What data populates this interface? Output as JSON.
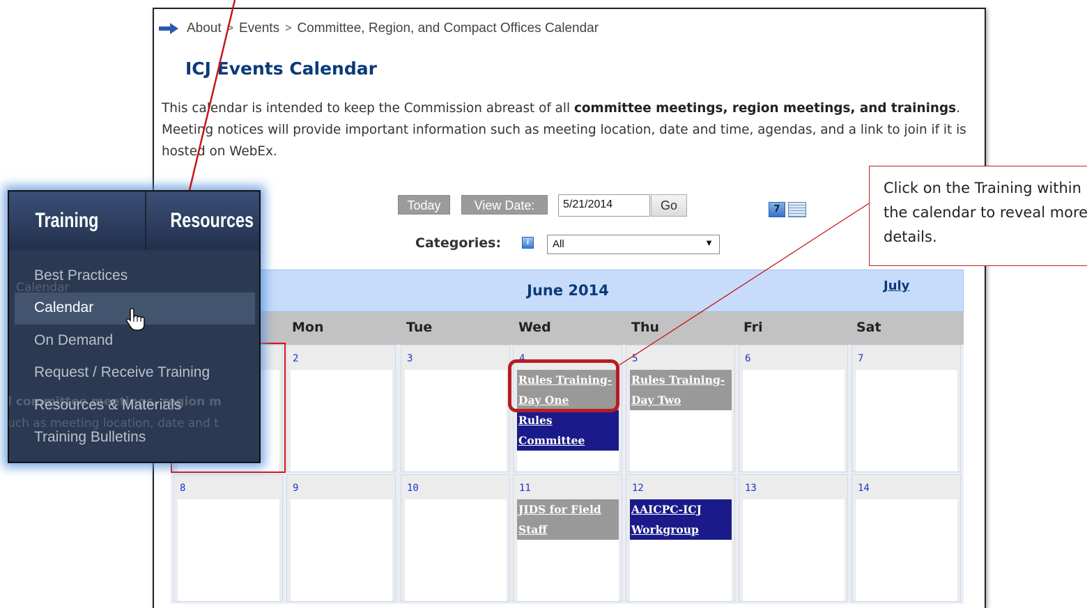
{
  "breadcrumb": {
    "items": [
      "About",
      "Events",
      "Committee, Region, and Compact Offices Calendar"
    ],
    "separator": ">"
  },
  "page": {
    "title": "ICJ Events Calendar",
    "intro_1": "This calendar is intended to keep the Commission abreast of all ",
    "intro_bold": "committee meetings, region meetings, and trainings",
    "intro_2": ". Meeting notices will provide important information such as meeting location, date and time, agendas, and a link to join if it is hosted on WebEx."
  },
  "controls": {
    "today_label": "Today",
    "view_date_label": "View Date:",
    "date_value": "5/21/2014",
    "go_label": "Go",
    "categories_label": "Categories:",
    "category_selected": "All",
    "info_glyph": "i",
    "cal7_glyph": "7"
  },
  "calendar": {
    "month": "June 2014",
    "next_month": "July",
    "days_of_week": [
      "Mon",
      "Tue",
      "Wed",
      "Thu",
      "Fri",
      "Sat"
    ],
    "week1": [
      "2",
      "3",
      "4",
      "5",
      "6",
      "7"
    ],
    "week2": [
      "8",
      "9",
      "10",
      "11",
      "12",
      "13",
      "14"
    ],
    "events": {
      "wed4_a1": "Rules Training-",
      "wed4_a2": "Day One",
      "wed4_b1": "Rules",
      "wed4_b2": "Committee",
      "thu5_a1": "Rules Training-",
      "thu5_a2": "Day Two",
      "wed11_a1": "JIDS for Field",
      "wed11_a2": "Staff",
      "thu12_a1": "AAICPC-ICJ",
      "thu12_a2": "Workgroup"
    }
  },
  "menu": {
    "tabs": [
      "Training",
      "Resources"
    ],
    "items": [
      "Best Practices",
      "Calendar",
      "On Demand",
      "Request / Receive Training",
      "Resources & Materials",
      "Training Bulletins"
    ],
    "active_index": 1,
    "ghost_calendar": "Calendar",
    "ghost_line1": "l committee meetings, region m",
    "ghost_line2": "uch as meeting location, date and t"
  },
  "callout": {
    "text": "Click on the Training within the calendar to reveal more details."
  },
  "colors": {
    "accent": "#0b3a78",
    "event_gray": "#999999",
    "event_navy": "#1a1a8a",
    "callout_border": "#b22222"
  },
  "icons": [
    "arrow-right-icon",
    "calendar-week-icon",
    "list-view-icon",
    "info-icon",
    "hand-cursor-icon"
  ]
}
